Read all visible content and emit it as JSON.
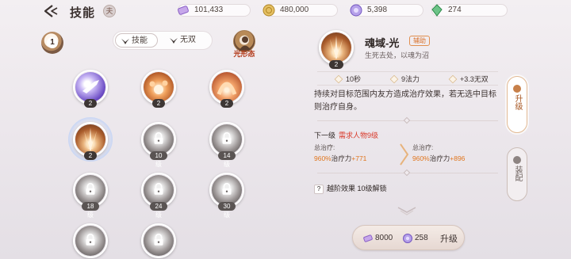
{
  "header": {
    "title": "技能",
    "badge": "夫"
  },
  "resources": [
    {
      "name": "purple-ticket",
      "value": "101,433",
      "color": "#b18adf"
    },
    {
      "name": "gold-coin",
      "value": "480,000",
      "color": "#d7aa4a"
    },
    {
      "name": "violet-gem",
      "value": "5,398",
      "color": "#9b7fd9"
    },
    {
      "name": "green-jade",
      "value": "274",
      "color": "#4aa866"
    }
  ],
  "left": {
    "level": "1",
    "tabs": [
      {
        "label": "技能",
        "active": true
      },
      {
        "label": "无双",
        "active": false
      }
    ],
    "form_label": "光形态"
  },
  "skills": [
    {
      "level": "2",
      "locked": false,
      "theme": "purple"
    },
    {
      "level": "2",
      "locked": false,
      "theme": "orange"
    },
    {
      "level": "2",
      "locked": false,
      "theme": "arc"
    },
    {
      "level": "2",
      "locked": false,
      "theme": "light",
      "selected": true
    },
    {
      "level": "10级",
      "locked": true
    },
    {
      "level": "14级",
      "locked": true
    },
    {
      "level": "18级",
      "locked": true
    },
    {
      "level": "24级",
      "locked": true
    },
    {
      "level": "30级",
      "locked": true
    },
    {
      "level": "",
      "locked": true
    },
    {
      "level": "",
      "locked": true
    }
  ],
  "detail": {
    "name": "魂域-光",
    "tag": "辅助",
    "subtitle": "生死去处，以魂为沼",
    "level": "2",
    "stats": [
      {
        "label": "10秒"
      },
      {
        "label": "9法力"
      },
      {
        "label": "+3.3无双"
      }
    ],
    "description": "持续对目标范围内友方造成治疗效果，若无选中目标则治疗自身。",
    "next_level": "下一级",
    "requirement": "需求人物9级",
    "current": {
      "label": "总治疗:",
      "pct": "960%",
      "rest": "治疗力",
      "add": "+771"
    },
    "next": {
      "label": "总治疗:",
      "pct": "960%",
      "rest": "治疗力",
      "add": "+896"
    },
    "breakthrough": "越阶效果 10级解锁"
  },
  "upgrade": {
    "cost1": "8000",
    "cost2": "258",
    "label": "升级"
  },
  "side_tabs": [
    {
      "label": "升级",
      "active": true
    },
    {
      "label": "装配",
      "active": false
    }
  ]
}
